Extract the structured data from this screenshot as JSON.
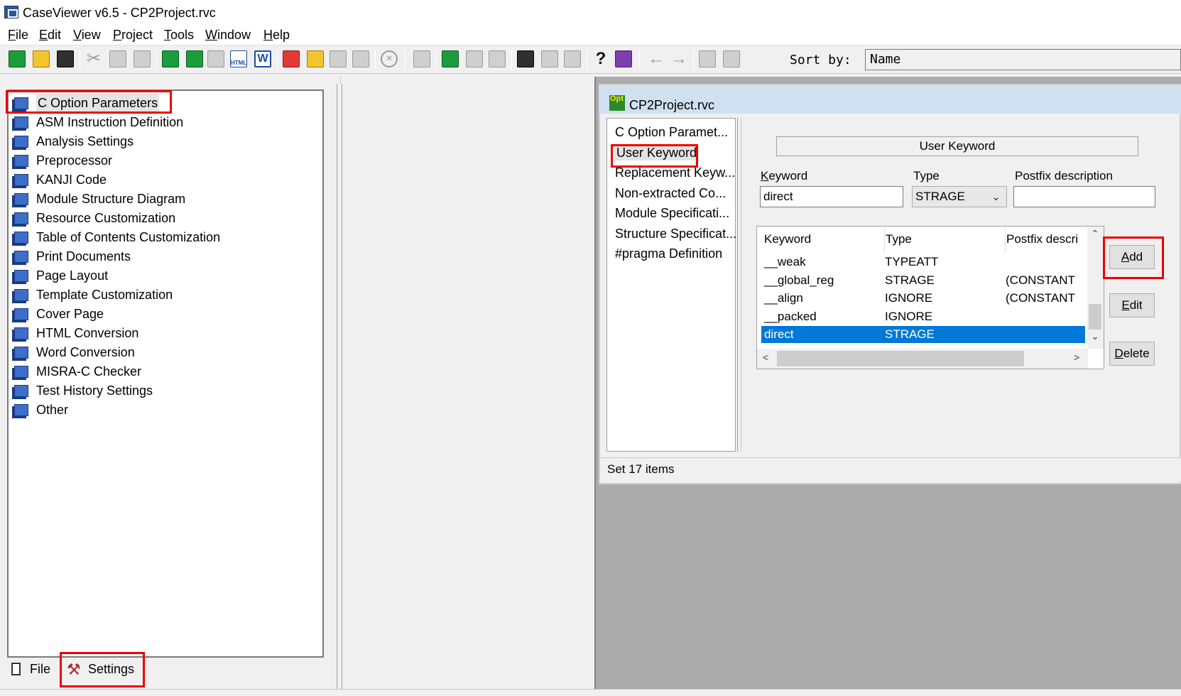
{
  "window": {
    "title": "CaseViewer v6.5 - CP2Project.rvc"
  },
  "menu": [
    {
      "label": "File"
    },
    {
      "label": "Edit"
    },
    {
      "label": "View"
    },
    {
      "label": "Project"
    },
    {
      "label": "Tools"
    },
    {
      "label": "Window"
    },
    {
      "label": "Help"
    }
  ],
  "toolbar": {
    "sort_label": "Sort by:",
    "sort_value": "Name",
    "html_text": "HTML",
    "word_text": "W",
    "help_text": "?"
  },
  "tree": {
    "items": [
      {
        "label": "C Option Parameters"
      },
      {
        "label": "ASM Instruction Definition"
      },
      {
        "label": "Analysis Settings"
      },
      {
        "label": "Preprocessor"
      },
      {
        "label": "KANJI Code"
      },
      {
        "label": "Module Structure Diagram"
      },
      {
        "label": "Resource Customization"
      },
      {
        "label": "Table of Contents Customization"
      },
      {
        "label": "Print Documents"
      },
      {
        "label": "Page Layout"
      },
      {
        "label": "Template Customization"
      },
      {
        "label": "Cover Page"
      },
      {
        "label": "HTML Conversion"
      },
      {
        "label": "Word Conversion"
      },
      {
        "label": "MISRA-C Checker"
      },
      {
        "label": "Test History Settings"
      },
      {
        "label": "Other"
      }
    ]
  },
  "bottom_tabs": {
    "file": "File",
    "settings": "Settings"
  },
  "dialog": {
    "title": "CP2Project.rvc",
    "icon_text": "Opt",
    "categories": [
      {
        "label": "C Option Paramet..."
      },
      {
        "label": "User Keyword"
      },
      {
        "label": "Replacement Keyw..."
      },
      {
        "label": "Non-extracted Co..."
      },
      {
        "label": "Module Specificati..."
      },
      {
        "label": "Structure Specificat..."
      },
      {
        "label": "#pragma Definition"
      }
    ],
    "section_title": "User Keyword",
    "fields": {
      "keyword_label": "Keyword",
      "keyword_value": "direct",
      "type_label": "Type",
      "type_value": "STRAGE",
      "postfix_label": "Postfix description",
      "postfix_value": ""
    },
    "table": {
      "headers": [
        "Keyword",
        "Type",
        "Postfix descri"
      ],
      "rows": [
        {
          "keyword": "__weak",
          "type": "TYPEATT",
          "postfix": ""
        },
        {
          "keyword": "__global_reg",
          "type": "STRAGE",
          "postfix": "(CONSTANT"
        },
        {
          "keyword": "__align",
          "type": "IGNORE",
          "postfix": "(CONSTANT"
        },
        {
          "keyword": "__packed",
          "type": "IGNORE",
          "postfix": ""
        },
        {
          "keyword": "direct",
          "type": "STRAGE",
          "postfix": ""
        }
      ]
    },
    "buttons": {
      "add": "Add",
      "edit": "Edit",
      "delete": "Delete"
    },
    "status": "Set 17 items"
  },
  "colors": {
    "selection": "#0078d7",
    "highlight_box": "#e00000"
  }
}
